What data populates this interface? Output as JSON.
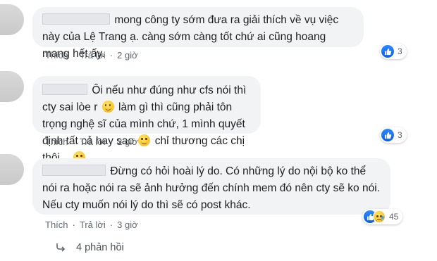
{
  "comments": [
    {
      "text_before": "mong công ty sớm đưa ra giải thích về vụ việc này của Lệ Trang ạ. càng sớm càng tốt chứ ai cũng hoang mang hết ấy.",
      "actions": {
        "like": "Thích",
        "reply": "Trả lời",
        "time": "2 giờ"
      },
      "reaction_count": "3"
    },
    {
      "segments": [
        "Ôi nếu như đúng như cfs nói thì cty sai lòe r ",
        " làm gì thì cũng phải tôn trọng nghệ sĩ của mình chứ, 1 mình quyết định tất cả hay sao ",
        " chỉ thương các chị thôi... "
      ],
      "actions": {
        "like": "Thích",
        "reply": "Trả lời",
        "time": "2 giờ"
      },
      "reaction_count": "3"
    },
    {
      "text": "Đừng có hỏi hoài lý do. Có những lý do nội bộ ko thể nói ra hoặc nói ra sẽ ảnh hưởng đến chính mem đó nên cty sẽ ko nói. Nếu cty muốn nói lý do thì sẽ có post khác.",
      "actions": {
        "like": "Thích",
        "reply": "Trả lời",
        "time": "3 giờ"
      },
      "reaction_count": "45"
    }
  ],
  "replies_label": "4 phản hồi",
  "colors": {
    "bubble": "#f2f3f5",
    "like_blue": "#1877f2",
    "meta_text": "#606770"
  }
}
